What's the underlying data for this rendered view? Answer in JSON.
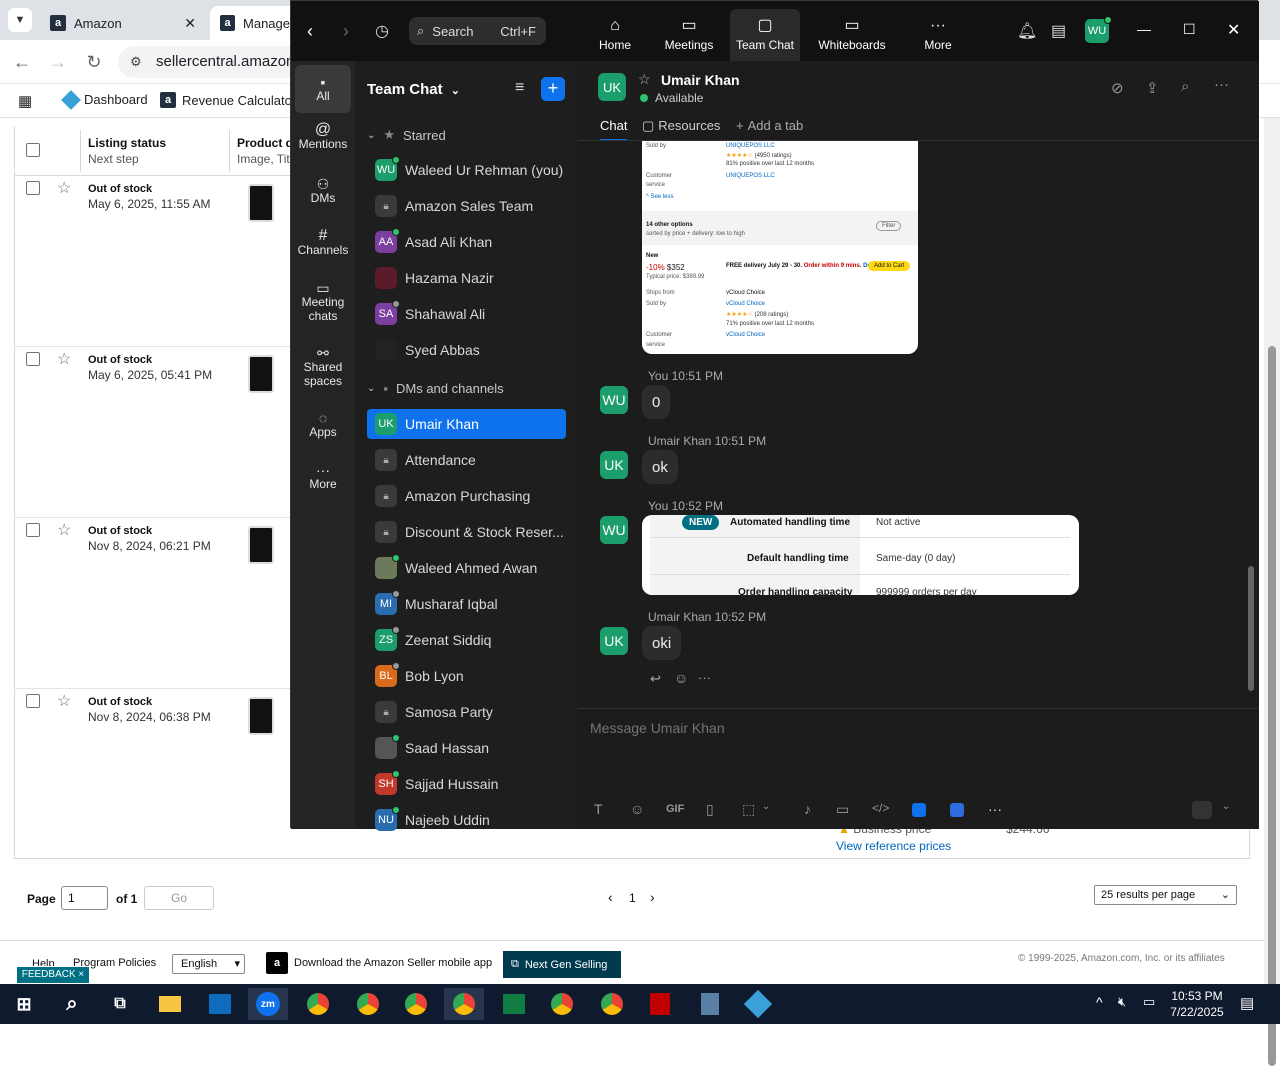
{
  "browser": {
    "tabs": [
      {
        "label": "Amazon"
      },
      {
        "label": "Manage"
      }
    ],
    "address": "sellercentral.amazon.c",
    "bookmarks": [
      "Dashboard",
      "Revenue Calculator"
    ]
  },
  "amazon": {
    "col_status": "Listing status",
    "col_next": "Next step",
    "col_product": "Product de",
    "col_product_sub": "Image, Titl",
    "rows": [
      {
        "status": "Out of stock",
        "date": "May 6, 2025, 11:55 AM"
      },
      {
        "status": "Out of stock",
        "date": "May 6, 2025, 05:41 PM"
      },
      {
        "status": "Out of stock",
        "date": "Nov 8, 2024, 06:21 PM"
      },
      {
        "status": "Out of stock",
        "date": "Nov 8, 2024, 06:38 PM"
      }
    ],
    "business_price": "Business price",
    "view_ref": "View reference prices",
    "price": "$244.66",
    "page_label": "Page",
    "page_value": "1",
    "of_label": "of 1",
    "go_label": "Go",
    "pager_current": "1",
    "per_page": "25 results per page",
    "footer": {
      "help": "Help",
      "policies": "Program Policies",
      "language": "English",
      "download": "Download the Amazon Seller mobile app",
      "next_gen": "Next Gen Selling",
      "copyright": "© 1999-2025, Amazon.com, Inc. or its affiliates",
      "feedback": "FEEDBACK ×"
    }
  },
  "zoom": {
    "search": "Search",
    "search_shortcut": "Ctrl+F",
    "top_nav": [
      "Home",
      "Meetings",
      "Team Chat",
      "Whiteboards",
      "More"
    ],
    "me_initials": "WU",
    "rail": [
      "All",
      "Mentions",
      "DMs",
      "Channels",
      "Meeting chats",
      "Shared spaces",
      "Apps",
      "More"
    ],
    "list_title": "Team Chat",
    "sections": {
      "starred": "Starred",
      "dms": "DMs and channels"
    },
    "starred": [
      {
        "name": "Waleed Ur Rehman (you)",
        "initials": "WU",
        "color": "#1b9e6b",
        "dot": "#2dc46f"
      },
      {
        "name": "Amazon Sales Team",
        "initials": "",
        "color": "#3a3a3a",
        "lock": true
      },
      {
        "name": "Asad Ali Khan",
        "initials": "AA",
        "color": "#7b3fa0",
        "dot": "#2dc46f"
      },
      {
        "name": "Hazama Nazir",
        "initials": "",
        "color": "#5a1c2a"
      },
      {
        "name": "Shahawal Ali",
        "initials": "SA",
        "color": "#7b3fa0",
        "dot": "#999"
      },
      {
        "name": "Syed Abbas",
        "initials": "",
        "color": "#222"
      }
    ],
    "dms": [
      {
        "name": "Umair Khan",
        "initials": "UK",
        "color": "#1b9e6b",
        "selected": true
      },
      {
        "name": "Attendance",
        "initials": "",
        "color": "#3a3a3a",
        "lock": true
      },
      {
        "name": "Amazon Purchasing",
        "initials": "",
        "color": "#3a3a3a",
        "lock": true
      },
      {
        "name": "Discount & Stock Reser...",
        "initials": "",
        "color": "#3a3a3a",
        "lock": true
      },
      {
        "name": "Waleed Ahmed Awan",
        "initials": "",
        "color": "#6a7a5a",
        "dot": "#2dc46f"
      },
      {
        "name": "Musharaf Iqbal",
        "initials": "MI",
        "color": "#2a6cb0",
        "dot": "#999"
      },
      {
        "name": "Zeenat Siddiq",
        "initials": "ZS",
        "color": "#1b9e6b",
        "dot": "#999"
      },
      {
        "name": "Bob Lyon",
        "initials": "BL",
        "color": "#d96a1a",
        "dot": "#999"
      },
      {
        "name": "Samosa Party",
        "initials": "",
        "color": "#3a3a3a",
        "lock": true
      },
      {
        "name": "Saad Hassan",
        "initials": "",
        "color": "#555",
        "dot": "#2dc46f"
      },
      {
        "name": "Sajjad Hussain",
        "initials": "SH",
        "color": "#c0392b",
        "dot": "#2dc46f"
      },
      {
        "name": "Najeeb Uddin",
        "initials": "NU",
        "color": "#2a6cb0",
        "dot": "#2dc46f"
      }
    ],
    "chat": {
      "name": "Umair Khan",
      "initials": "UK",
      "presence": "Available",
      "tabs": [
        "Chat",
        "Resources",
        "Add a tab"
      ],
      "shot1": {
        "sold_by": "Sold by",
        "uniquepos": "UNIQUEPOS LLC",
        "rating": "(4950 ratings)",
        "positive": "81% positive over last 12 months",
        "customer": "Customer",
        "service": "service",
        "see_less": "^ See less",
        "other": "14 other options",
        "sorted": "sorted by price + delivery: low to high",
        "filter": "Filter",
        "new": "New",
        "discount": "-10%",
        "price": "$352",
        "typical": "Typical price: $389.99",
        "delivery": "FREE delivery July 29 - 30.",
        "order": "Order within 9 mins.",
        "details": "Details",
        "add": "Add to Cart",
        "ships_from": "Ships from",
        "vcloud": "vCloud Choice",
        "sold_by2": "Sold by",
        "vcloud2": "vCloud Choice",
        "rating2": "(208 ratings)",
        "positive2": "71% positive over last 12 months",
        "customer2": "Customer",
        "service2": "service",
        "vcloud3": "vCloud Choice"
      },
      "messages": [
        {
          "who": "You",
          "time": "10:51 PM",
          "text": "0",
          "initials": "WU"
        },
        {
          "who": "Umair Khan",
          "time": "10:51 PM",
          "text": "ok",
          "initials": "UK"
        },
        {
          "who": "You",
          "time": "10:52 PM",
          "text": "",
          "initials": "WU"
        },
        {
          "who": "Umair Khan",
          "time": "10:52 PM",
          "text": "oki",
          "initials": "UK"
        }
      ],
      "shot2": {
        "new": "NEW",
        "r1_label": "Automated handling time",
        "r1_value": "Not active",
        "r2_label": "Default handling time",
        "r2_value": "Same-day (0 day)",
        "r3_label": "Order handling capacity",
        "r3_value": "999999 orders per day"
      },
      "placeholder": "Message Umair Khan",
      "gif": "GIF"
    }
  },
  "taskbar": {
    "time": "10:53 PM",
    "date": "7/22/2025"
  }
}
